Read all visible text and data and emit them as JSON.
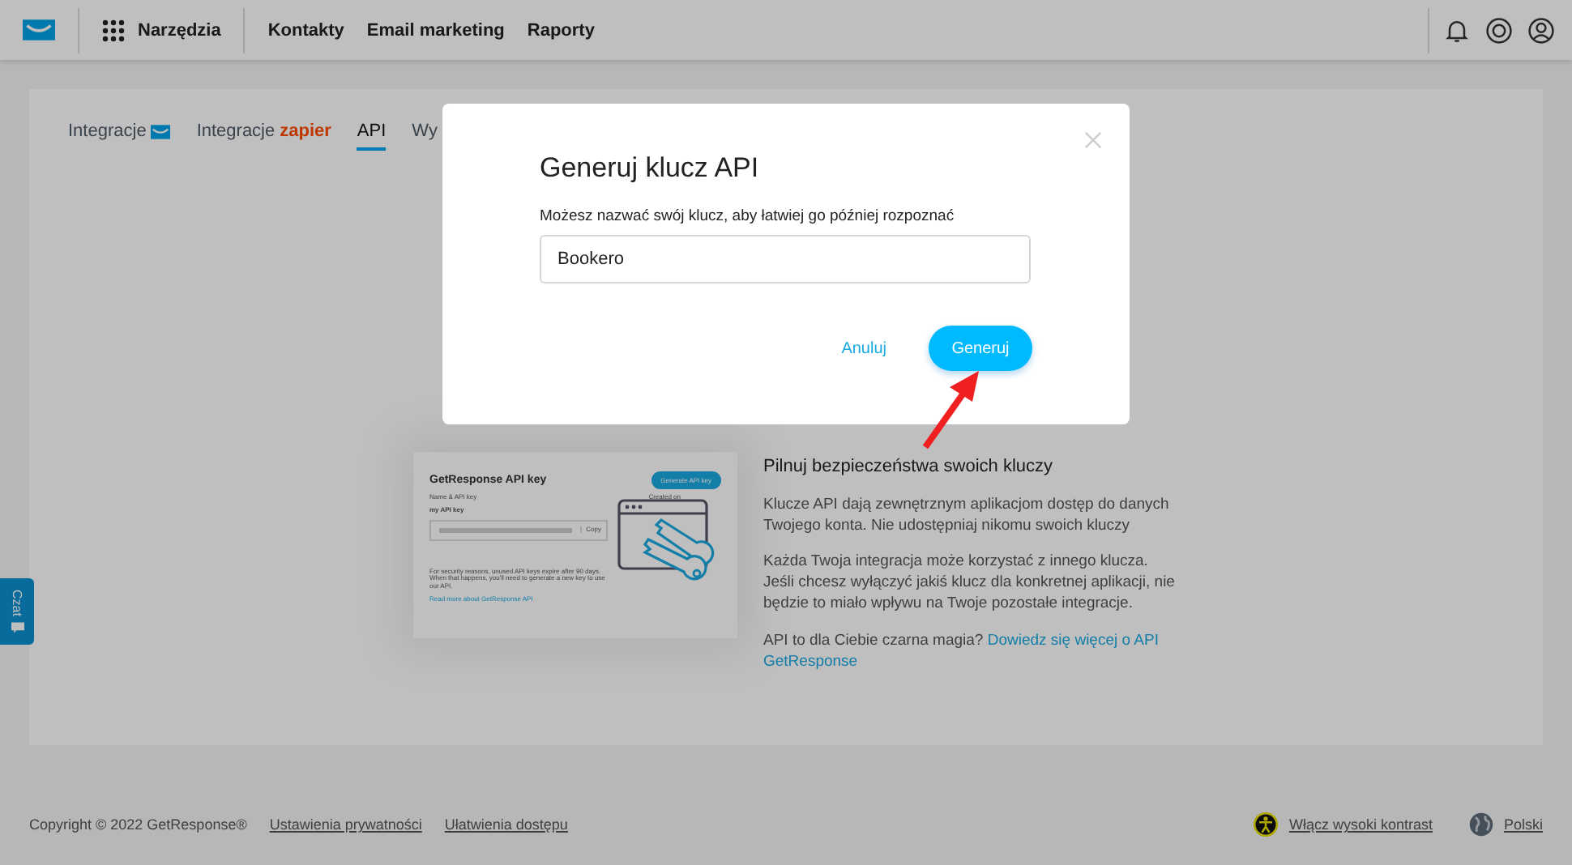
{
  "header": {
    "tools": "Narzędzia",
    "nav": [
      "Kontakty",
      "Email marketing",
      "Raporty"
    ]
  },
  "tabs": [
    {
      "label": "Integracje",
      "kind": "icon",
      "selected": false
    },
    {
      "label": "Integracje",
      "kind": "brand",
      "brand": "zapier",
      "selected": false
    },
    {
      "label": "API",
      "kind": "plain",
      "selected": true
    },
    {
      "label": "Wy",
      "kind": "plain",
      "selected": false
    }
  ],
  "illustration": {
    "title": "GetResponse API key",
    "button": "Generate API key",
    "name_label": "Name & API key",
    "created_label": "Created on",
    "key_label": "my API key",
    "copy": "Copy",
    "note": "For security reasons, unused API keys expire after 90 days. When that happens, you'll need to generate a new key to use our API.",
    "link": "Read more about GetResponse API"
  },
  "info": {
    "title": "Pilnuj bezpieczeństwa swoich kluczy",
    "paragraphs": [
      "Klucze API dają zewnętrznym aplikacjom dostęp do danych Twojego konta. Nie udostępniaj nikomu swoich kluczy",
      "Każda Twoja integracja może korzystać z innego klucza. Jeśli chcesz wyłączyć jakiś klucz dla konkretnej aplikacji, nie będzie to miało wpływu na Twoje pozostałe integracje."
    ],
    "question": "API to dla Ciebie czarna magia?",
    "link": "Dowiedz się więcej o API GetResponse"
  },
  "chat": {
    "label": "Czat"
  },
  "footer": {
    "copyright": "Copyright © 2022 GetResponse®",
    "links": [
      "Ustawienia prywatności",
      "Ułatwienia dostępu"
    ],
    "contrast": "Włącz wysoki kontrast",
    "language": "Polski"
  },
  "modal": {
    "title": "Generuj klucz API",
    "label": "Możesz nazwać swój klucz, aby łatwiej go później rozpoznać",
    "value": "Bookero",
    "cancel": "Anuluj",
    "submit": "Generuj"
  }
}
